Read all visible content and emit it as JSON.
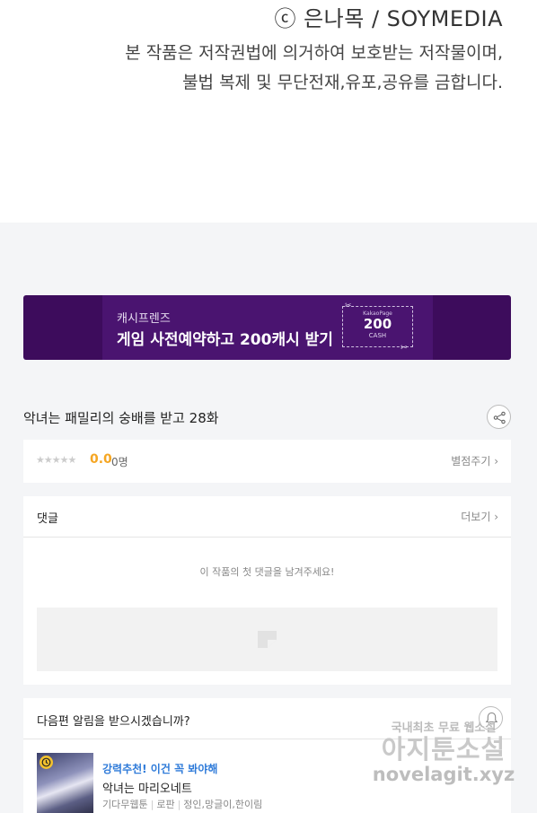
{
  "copyright": {
    "brand": "ⓒ 은나목 / SOYMEDIA",
    "line1": "본 작품은 저작권법에 의거하여 보호받는 저작물이며,",
    "line2": "불법 복제 및 무단전재,유포,공유를 금합니다."
  },
  "banner": {
    "subtitle": "캐시프렌즈",
    "title": "게임 사전예약하고 200캐시 받기",
    "coupon_top": "KakaoPage",
    "coupon_amount": "200",
    "coupon_unit": "CASH",
    "accent": "#3d0c5c"
  },
  "episode": {
    "title": "악녀는 패밀리의 숭배를 받고 28화",
    "share_icon": "share-icon"
  },
  "rating": {
    "stars": "★★★★★",
    "score": "0.0",
    "people": "0명",
    "rate_link": "별점주기 ›"
  },
  "comments": {
    "label": "댓글",
    "more_link": "더보기 ›",
    "empty_message": "이 작품의 첫 댓글을 남겨주세요!",
    "input_icon": "pencil-icon"
  },
  "alarm": {
    "question": "다음편 알림을 받으시겠습니까?",
    "bell_icon": "bell-icon"
  },
  "recommend": {
    "tag": "강력추천! 이건 꼭 봐야해",
    "title": "악녀는 마리오네트",
    "meta": [
      "기다무웹툰",
      "로판",
      "정인,망글이,한이림"
    ],
    "tag_color": "#2f7bd9"
  },
  "watermark": {
    "small": "국내최초 무료 웹소설",
    "big": "아지툰소설",
    "url": "novelagit.xyz"
  }
}
